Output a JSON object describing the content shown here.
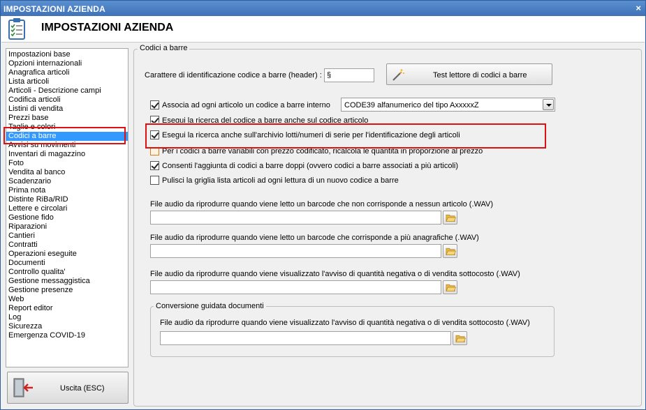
{
  "window": {
    "title": "IMPOSTAZIONI AZIENDA",
    "close_glyph": "×"
  },
  "header": {
    "title": "IMPOSTAZIONI AZIENDA",
    "icon": "clipboard-checklist-icon"
  },
  "sidebar": {
    "items": [
      "Impostazioni base",
      "Opzioni internazionali",
      "Anagrafica articoli",
      "Lista articoli",
      "Articoli - Descrizione campi",
      "Codifica articoli",
      "Listini di vendita",
      "Prezzi base",
      "Taglie e colori",
      "Codici a barre",
      "Avvisi su movimenti",
      "Inventari di magazzino",
      "Foto",
      "Vendita al banco",
      "Scadenzario",
      "Prima nota",
      "Distinte RiBa/RID",
      "Lettere e circolari",
      "Gestione fido",
      "Riparazioni",
      "Cantieri",
      "Contratti",
      "Operazioni eseguite",
      "Documenti",
      "Controllo qualita'",
      "Gestione messaggistica",
      "Gestione presenze",
      "Web",
      "Report editor",
      "Log",
      "Sicurezza",
      "Emergenza COVID-19"
    ],
    "selected_index": 9
  },
  "exit_button": {
    "label": "Uscita (ESC)",
    "icon": "exit-door-arrow-icon"
  },
  "panel": {
    "group_title": "Codici a barre",
    "header_char_label": "Carattere di identificazione codice a barre (header) :",
    "header_char_value": "§",
    "test_button_label": "Test lettore di codici a barre",
    "test_button_icon": "magic-wand-icon",
    "checkboxes": [
      {
        "label": "Associa ad ogni articolo un codice a barre interno",
        "checked": true
      },
      {
        "label": "Esegui la ricerca del codice a barre anche sul codice articolo",
        "checked": true
      },
      {
        "label": "Esegui la ricerca anche sull'archivio lotti/numeri di serie per l'identificazione degli articoli",
        "checked": true
      },
      {
        "label": "Per i codici a barre variabili con prezzo codificato, ricalcola le quantita in proporzione al prezzo",
        "checked": false
      },
      {
        "label": "Consenti l'aggiunta di codici a barre doppi (ovvero codici a barre associati a più articoli)",
        "checked": true
      },
      {
        "label": "Pulisci la griglia lista articoli ad ogni lettura di un nuovo codice a barre",
        "checked": false
      }
    ],
    "barcode_type": {
      "selected": "CODE39 alfanumerico del tipo AxxxxxZ"
    },
    "audio_fields": [
      {
        "label": "File audio da riprodurre quando viene letto un barcode che non corrisponde a nessun articolo (.WAV)",
        "value": ""
      },
      {
        "label": "File audio da riprodurre quando viene letto un barcode che corrisponde a più anagrafiche (.WAV)",
        "value": ""
      },
      {
        "label": "File audio da riprodurre quando viene visualizzato l'avviso di quantità negativa o di vendita sottocosto (.WAV)",
        "value": ""
      }
    ],
    "conversion_group": {
      "title": "Conversione guidata documenti",
      "audio_label": "File audio da riprodurre quando viene visualizzato l'avviso di quantità negativa o di vendita sottocosto (.WAV)",
      "audio_value": ""
    },
    "folder_icon": "folder-open-icon"
  },
  "colors": {
    "selection": "#3399ff",
    "highlight": "#e01010",
    "titlebar": "#3f72b8"
  }
}
